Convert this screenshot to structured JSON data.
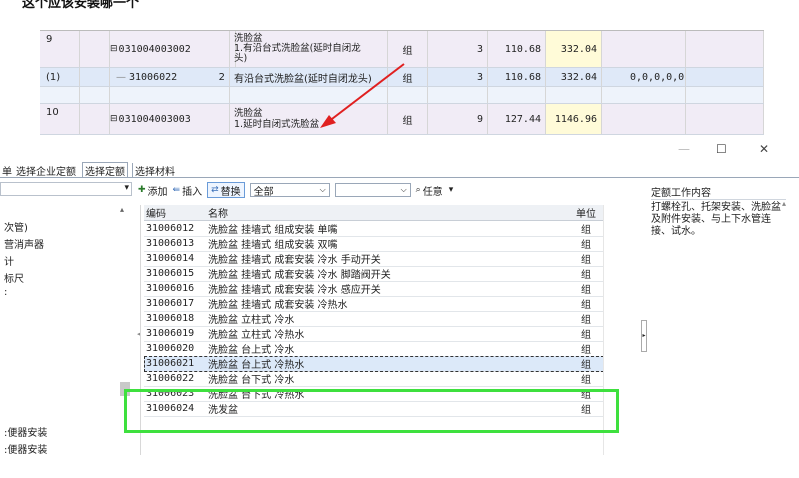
{
  "question_title": "这个应该安装哪一个",
  "upper_rows": [
    {
      "seq": "9",
      "code": "031004003002",
      "idx": "",
      "desc": "洗脸盆",
      "desc2": "1.有沿台式洗脸盆(延时自闭龙",
      "desc3": "头)",
      "unit": "组",
      "qty": "3",
      "price": "110.68",
      "total": "332.04",
      "extra": ""
    },
    {
      "seq": "(1)",
      "code": "31006022",
      "idx": "2",
      "desc": "有沿台式洗脸盆(延时自闭龙头)",
      "unit": "组",
      "qty": "3",
      "price": "110.68",
      "total": "332.04",
      "extra": "0,0,0,0,0"
    },
    {
      "seq": "10",
      "code": "031004003003",
      "idx": "",
      "desc": "洗脸盆",
      "desc2": "1.延时自闭式洗脸盆",
      "unit": "组",
      "qty": "9",
      "price": "127.44",
      "total": "1146.96",
      "extra": ""
    }
  ],
  "window_controls": {
    "minimize": "—",
    "maximize": "☐",
    "close": "✕"
  },
  "tabs": [
    {
      "label": "单"
    },
    {
      "label": "选择企业定额"
    },
    {
      "label": "选择定额"
    },
    {
      "label": "选择材料"
    }
  ],
  "left_tree": [
    "次管)",
    "营消声器",
    "计",
    "标尺",
    ":",
    ":便器安装",
    ":便器安装"
  ],
  "toolbar": {
    "add": "添加",
    "insert": "插入",
    "replace": "替换",
    "filter_value": "全部",
    "search_value": "",
    "any_label": "任意"
  },
  "grid": {
    "headers": {
      "code": "编码",
      "name": "名称",
      "unit": "单位"
    },
    "rows": [
      {
        "code": "31006012",
        "name": "洗脸盆 挂墙式 组成安装 单嘴",
        "unit": "组"
      },
      {
        "code": "31006013",
        "name": "洗脸盆 挂墙式 组成安装 双嘴",
        "unit": "组"
      },
      {
        "code": "31006014",
        "name": "洗脸盆 挂墙式 成套安装 冷水 手动开关",
        "unit": "组"
      },
      {
        "code": "31006015",
        "name": "洗脸盆 挂墙式 成套安装 冷水 脚踏阀开关",
        "unit": "组"
      },
      {
        "code": "31006016",
        "name": "洗脸盆 挂墙式 成套安装 冷水 感应开关",
        "unit": "组"
      },
      {
        "code": "31006017",
        "name": "洗脸盆 挂墙式 成套安装 冷热水",
        "unit": "组"
      },
      {
        "code": "31006018",
        "name": "洗脸盆 立柱式 冷水",
        "unit": "组"
      },
      {
        "code": "31006019",
        "name": "洗脸盆 立柱式 冷热水",
        "unit": "组"
      },
      {
        "code": "31006020",
        "name": "洗脸盆 台上式 冷水",
        "unit": "组"
      },
      {
        "code": "31006021",
        "name": "洗脸盆 台上式 冷热水",
        "unit": "组"
      },
      {
        "code": "31006022",
        "name": "洗脸盆 台下式 冷水",
        "unit": "组"
      },
      {
        "code": "31006023",
        "name": "洗脸盆 台下式 冷热水",
        "unit": "组"
      },
      {
        "code": "31006024",
        "name": "洗发盆",
        "unit": "组"
      }
    ],
    "selected_index": 9
  },
  "right_panel": {
    "title": "定额工作内容",
    "description": "打螺栓孔、托架安装、洗脸盆及附件安装、与上下水管连接、试水。"
  },
  "colors": {
    "highlight_green": "#3ee03e",
    "arrow_red": "#e02020",
    "selected_row": "#dce9f9",
    "section_row": "#f1ecf6",
    "child_row": "#dfe9f8"
  }
}
